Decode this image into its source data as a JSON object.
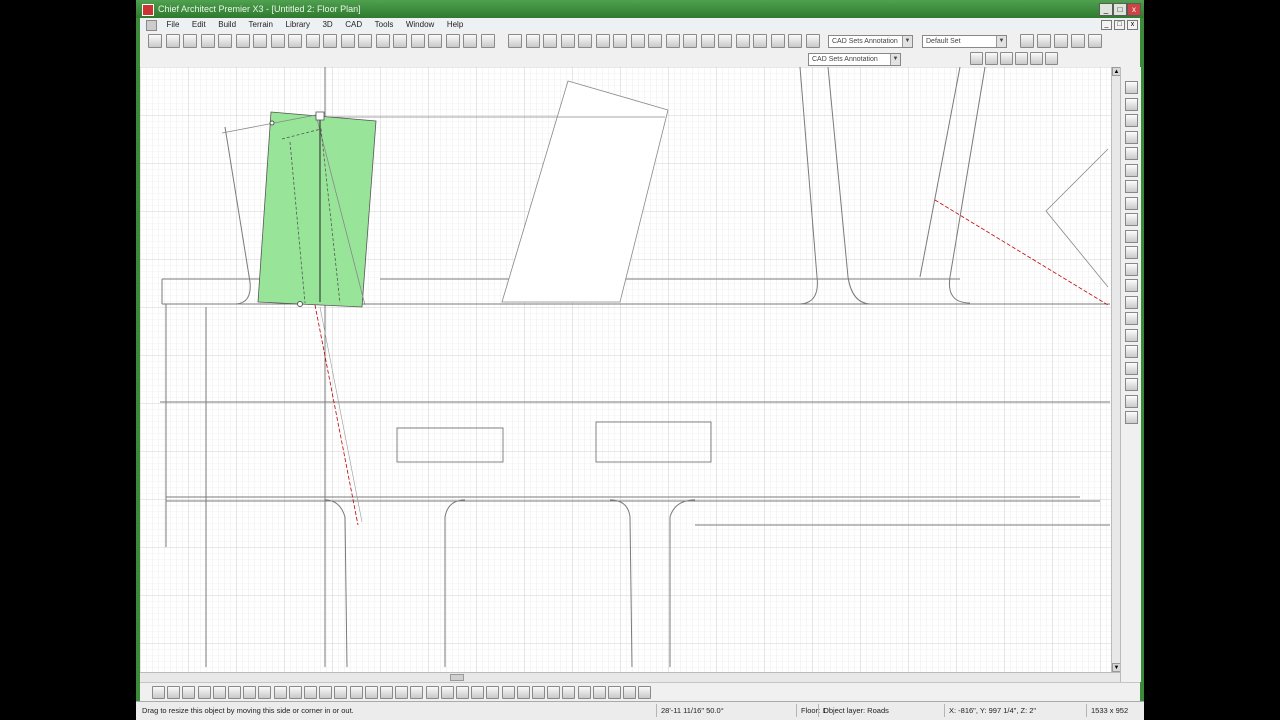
{
  "window": {
    "title": "Chief Architect Premier X3 - [Untitled 2: Floor Plan]",
    "controls": {
      "minimize": "_",
      "maximize": "□",
      "close": "x"
    }
  },
  "menubar": {
    "items": [
      "File",
      "Edit",
      "Build",
      "Terrain",
      "Library",
      "3D",
      "CAD",
      "Tools",
      "Window",
      "Help"
    ],
    "mdi_controls": {
      "minimize": "_",
      "restore": "□",
      "close": "x"
    }
  },
  "toolbar": {
    "annotation_set_value": "CAD Sets Annotation",
    "layer_set_value": "Default Set",
    "layer_display_value": "CAD Sets Annotation",
    "text_style_number": "1"
  },
  "icons": {
    "select": "select-objects-icon",
    "walls": "walls-icon",
    "cabinets": "cabinet-icon",
    "doors": "door-icon",
    "windows": "window-icon",
    "stairs": "stairs-icon",
    "roof": "roof-icon",
    "camera": "camera-icon",
    "zoom": "zoom-icon"
  },
  "statusbar": {
    "hint": "Drag to resize this object by moving this side or corner in or out.",
    "angle_length": "28'-11 11/16\"  50.0°",
    "floor": "Floor: 1",
    "layer": "Object layer: Roads",
    "coordinates": "X: -816\", Y: 997 1/4\", Z: 2\"",
    "resolution": "1533 x 952"
  },
  "colors": {
    "title_bar": "#3a8a3a",
    "selection_fill": "#98e59a",
    "grid": "#d4d4d4",
    "canvas": "#ffffff",
    "road_outline": "#7a7a7a",
    "dimension_line": "#c00000"
  }
}
